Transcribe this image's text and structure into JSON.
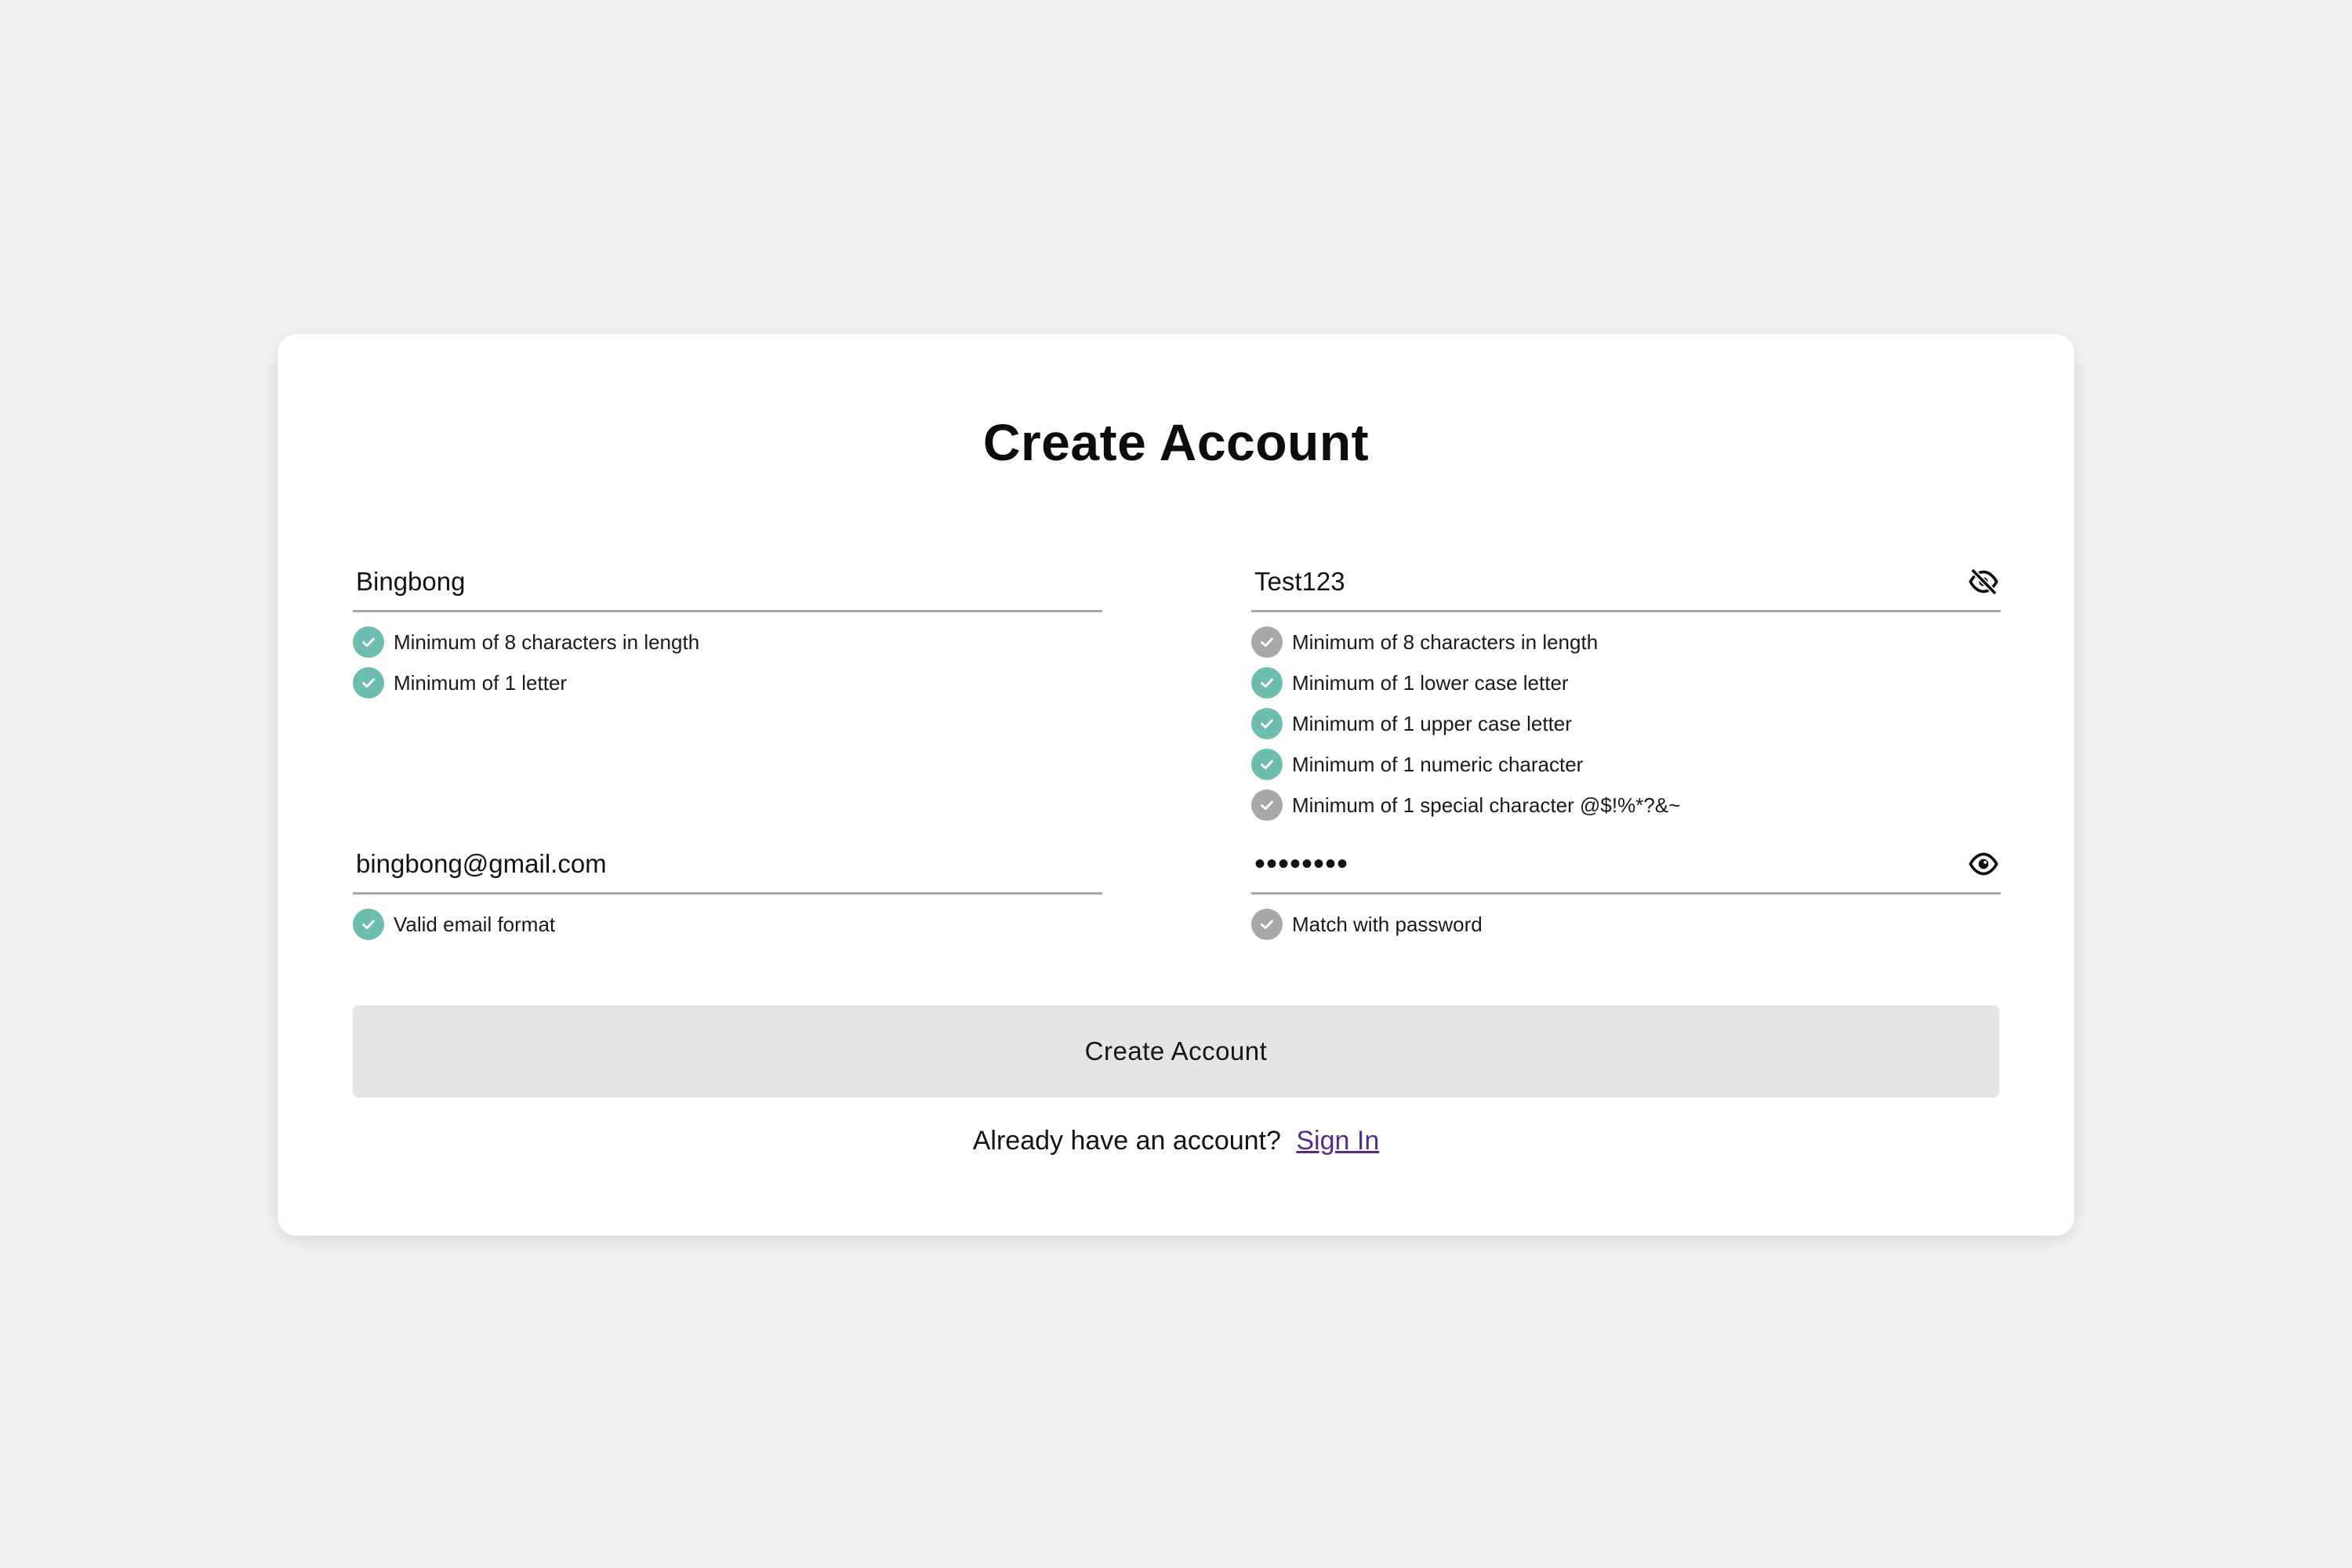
{
  "page": {
    "title": "Create Account"
  },
  "colors": {
    "background": "#f1f1f1",
    "card": "#ffffff",
    "check_valid": "#6dbdb1",
    "check_pending": "#a7a7a7",
    "button_bg": "#e5e5e5",
    "link": "#5a2b86"
  },
  "username": {
    "value": "Bingbong",
    "rules": [
      {
        "label": "Minimum of 8 characters in length",
        "status": "valid"
      },
      {
        "label": "Minimum of 1 letter",
        "status": "valid"
      }
    ]
  },
  "password": {
    "value": "Test123",
    "visible": true,
    "toggle_icon": "eye-slash-icon",
    "rules": [
      {
        "label": "Minimum of 8 characters in length",
        "status": "pending"
      },
      {
        "label": "Minimum of 1 lower case letter",
        "status": "valid"
      },
      {
        "label": "Minimum of 1 upper case letter",
        "status": "valid"
      },
      {
        "label": "Minimum of 1 numeric character",
        "status": "valid"
      },
      {
        "label": "Minimum of 1 special character @$!%*?&~",
        "status": "pending"
      }
    ]
  },
  "email": {
    "value": "bingbong@gmail.com",
    "rules": [
      {
        "label": "Valid email format",
        "status": "valid"
      }
    ]
  },
  "confirm_password": {
    "value": "••••••••",
    "visible": false,
    "toggle_icon": "eye-icon",
    "rules": [
      {
        "label": "Match with password",
        "status": "pending"
      }
    ]
  },
  "submit": {
    "label": "Create Account"
  },
  "footer": {
    "prompt": "Already have an account?",
    "link_label": "Sign In"
  }
}
